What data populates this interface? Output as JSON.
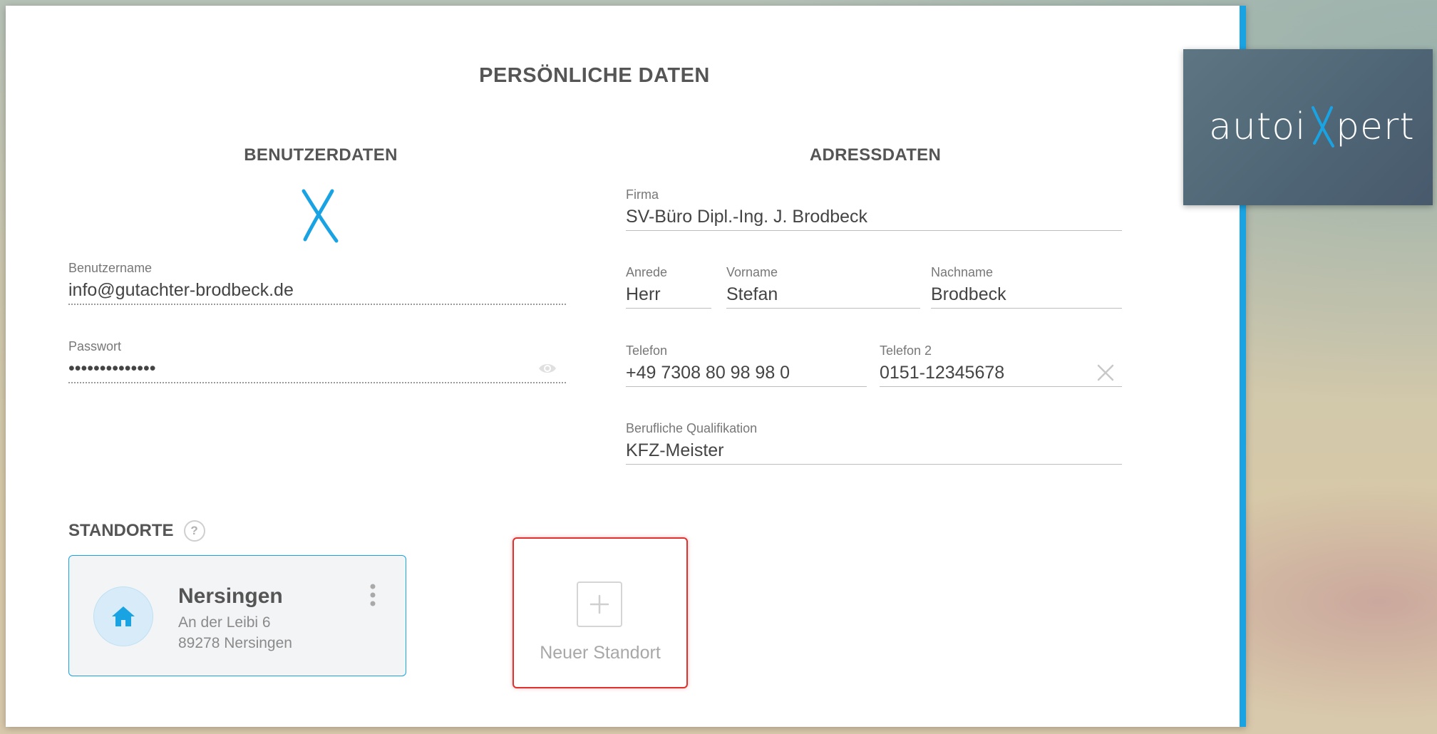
{
  "page_title": "PERSÖNLICHE DATEN",
  "user_section": {
    "title": "BENUTZERDATEN",
    "username": {
      "label": "Benutzername",
      "value": "info@gutachter-brodbeck.de"
    },
    "password": {
      "label": "Passwort",
      "value": "••••••••••••••"
    }
  },
  "address_section": {
    "title": "ADRESSDATEN",
    "company": {
      "label": "Firma",
      "value": "SV-Büro Dipl.-Ing. J. Brodbeck"
    },
    "salutation": {
      "label": "Anrede",
      "value": "Herr"
    },
    "first_name": {
      "label": "Vorname",
      "value": "Stefan"
    },
    "last_name": {
      "label": "Nachname",
      "value": "Brodbeck"
    },
    "phone": {
      "label": "Telefon",
      "value": "+49 7308 80 98 98 0"
    },
    "phone2": {
      "label": "Telefon 2",
      "value": "0151-12345678"
    },
    "qualification": {
      "label": "Berufliche Qualifikation",
      "value": "KFZ-Meister"
    }
  },
  "locations": {
    "title": "STANDORTE",
    "help": "?",
    "items": [
      {
        "name": "Nersingen",
        "street": "An der Leibi 6",
        "city": "89278 Nersingen"
      }
    ],
    "new_label": "Neuer Standort"
  },
  "brand": {
    "name": "autoiXpert"
  },
  "colors": {
    "accent": "#1aa3e3",
    "highlight": "#e03030"
  }
}
